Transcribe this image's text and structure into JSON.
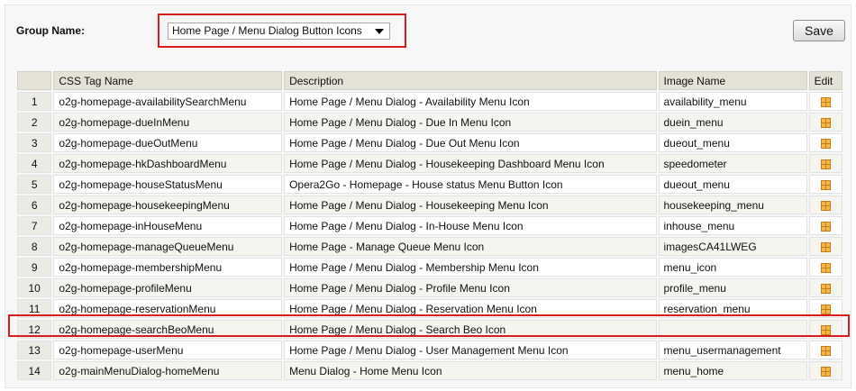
{
  "header": {
    "group_label": "Group Name:",
    "group_selected": "Home Page / Menu Dialog Button Icons",
    "save_label": "Save"
  },
  "table": {
    "columns": [
      "",
      "CSS Tag Name",
      "Description",
      "Image Name",
      "Edit"
    ],
    "rows": [
      {
        "num": "1",
        "css": "o2g-homepage-availabilitySearchMenu",
        "desc": "Home Page / Menu Dialog - Availability Menu Icon",
        "image": "availability_menu"
      },
      {
        "num": "2",
        "css": "o2g-homepage-dueInMenu",
        "desc": "Home Page / Menu Dialog - Due In Menu Icon",
        "image": "duein_menu"
      },
      {
        "num": "3",
        "css": "o2g-homepage-dueOutMenu",
        "desc": "Home Page / Menu Dialog - Due Out Menu Icon",
        "image": "dueout_menu"
      },
      {
        "num": "4",
        "css": "o2g-homepage-hkDashboardMenu",
        "desc": "Home Page / Menu Dialog - Housekeeping Dashboard Menu Icon",
        "image": "speedometer"
      },
      {
        "num": "5",
        "css": "o2g-homepage-houseStatusMenu",
        "desc": "Opera2Go - Homepage - House status Menu Button Icon",
        "image": "dueout_menu"
      },
      {
        "num": "6",
        "css": "o2g-homepage-housekeepingMenu",
        "desc": "Home Page / Menu Dialog - Housekeeping Menu Icon",
        "image": "housekeeping_menu"
      },
      {
        "num": "7",
        "css": "o2g-homepage-inHouseMenu",
        "desc": "Home Page / Menu Dialog - In-House Menu Icon",
        "image": "inhouse_menu"
      },
      {
        "num": "8",
        "css": "o2g-homepage-manageQueueMenu",
        "desc": "Home Page - Manage Queue Menu Icon",
        "image": "imagesCA41LWEG"
      },
      {
        "num": "9",
        "css": "o2g-homepage-membershipMenu",
        "desc": "Home Page / Menu Dialog - Membership Menu Icon",
        "image": "menu_icon"
      },
      {
        "num": "10",
        "css": "o2g-homepage-profileMenu",
        "desc": "Home Page / Menu Dialog - Profile Menu Icon",
        "image": "profile_menu"
      },
      {
        "num": "11",
        "css": "o2g-homepage-reservationMenu",
        "desc": "Home Page / Menu Dialog - Reservation Menu Icon",
        "image": "reservation_menu"
      },
      {
        "num": "12",
        "css": "o2g-homepage-searchBeoMenu",
        "desc": "Home Page / Menu Dialog - Search Beo Icon",
        "image": ""
      },
      {
        "num": "13",
        "css": "o2g-homepage-userMenu",
        "desc": "Home Page / Menu Dialog - User Management Menu Icon",
        "image": "menu_usermanagement"
      },
      {
        "num": "14",
        "css": "o2g-mainMenuDialog-homeMenu",
        "desc": "Menu Dialog - Home Menu Icon",
        "image": "menu_home"
      }
    ]
  },
  "colors": {
    "highlight": "#d71e1e",
    "header_bg": "#e4e1d6",
    "edit_icon": "#f4b847"
  },
  "icons": {
    "edit": "edit-grid-icon",
    "dropdown": "chevron-down-icon"
  }
}
